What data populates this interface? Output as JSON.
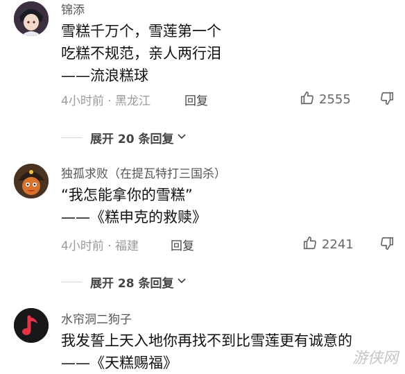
{
  "comments": [
    {
      "username": "锦添",
      "lines": [
        "雪糕千万个，雪莲第一个",
        "吃糕不规范，亲人两行泪",
        "——流浪糕球"
      ],
      "meta": "4小时前 · 黑龙江",
      "reply_label": "回复",
      "likes": "2555",
      "expand_label": "展开 20 条回复"
    },
    {
      "username": "独孤求败（在提瓦特打三国杀）",
      "lines": [
        "“我怎能拿你的雪糕”",
        "——《糕申克的救赎》"
      ],
      "meta": "4小时前 · 福建",
      "reply_label": "回复",
      "likes": "2241",
      "expand_label": "展开 28 条回复"
    },
    {
      "username": "水帘洞二狗子",
      "lines": [
        "我发誓上天入地你再找不到比雪莲更有诚意的",
        "——《天糕赐福》"
      ]
    }
  ],
  "watermark": "游侠网",
  "colors": {
    "accent_avatar3": "#e8334a",
    "meta": "#9a9a9a"
  },
  "icons": [
    "thumb-up-icon",
    "thumb-down-icon",
    "chevron-down-icon",
    "music-note-icon"
  ]
}
